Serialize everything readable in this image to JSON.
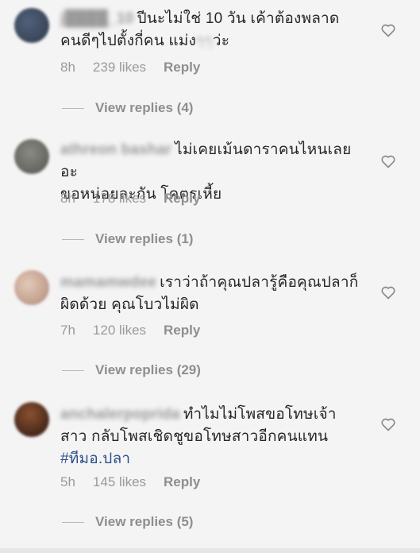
{
  "comments": [
    {
      "username": "j████_10",
      "lines": [
        "ปีนะไม่ใช่ 10 วัน เค้าต้องพลาด",
        "คนดีๆไปตั้งกี่คน แม่ง"
      ],
      "line2_tail": "ว่ะ",
      "time": "8h",
      "likes": "239 likes",
      "reply": "Reply",
      "view_replies": "View replies (4)",
      "avatar_color": "#2f3a4a"
    },
    {
      "username": "athreon bashar",
      "lines": [
        "ไม่เคยเม้นดาราคนไหนเลยอะ",
        "ขอหน่อยละกัน โคตรเหี้ย"
      ],
      "time": "8h",
      "likes": "178 likes",
      "reply": "Reply",
      "view_replies": "View replies (1)",
      "avatar_color": "#6b6b66"
    },
    {
      "username": "mamamwdee",
      "lines": [
        "เราว่าถ้าคุณปลารู้คือคุณปลาก็",
        "ผิดด้วย คุณโบวไม่ผิด"
      ],
      "time": "7h",
      "likes": "120 likes",
      "reply": "Reply",
      "view_replies": "View replies (29)",
      "avatar_color": "#c9a896"
    },
    {
      "username": "anchalerpoprida",
      "lines": [
        "ทำไมไม่โพสขอโทษเจ้า",
        "สาว กลับโพสเชิดชูขอโทษสาวอีกคนแทน"
      ],
      "hashtag": "#ทีมอ.ปลา",
      "time": "5h",
      "likes": "145 likes",
      "reply": "Reply",
      "view_replies": "View replies (5)",
      "avatar_color": "#3a2418"
    }
  ]
}
